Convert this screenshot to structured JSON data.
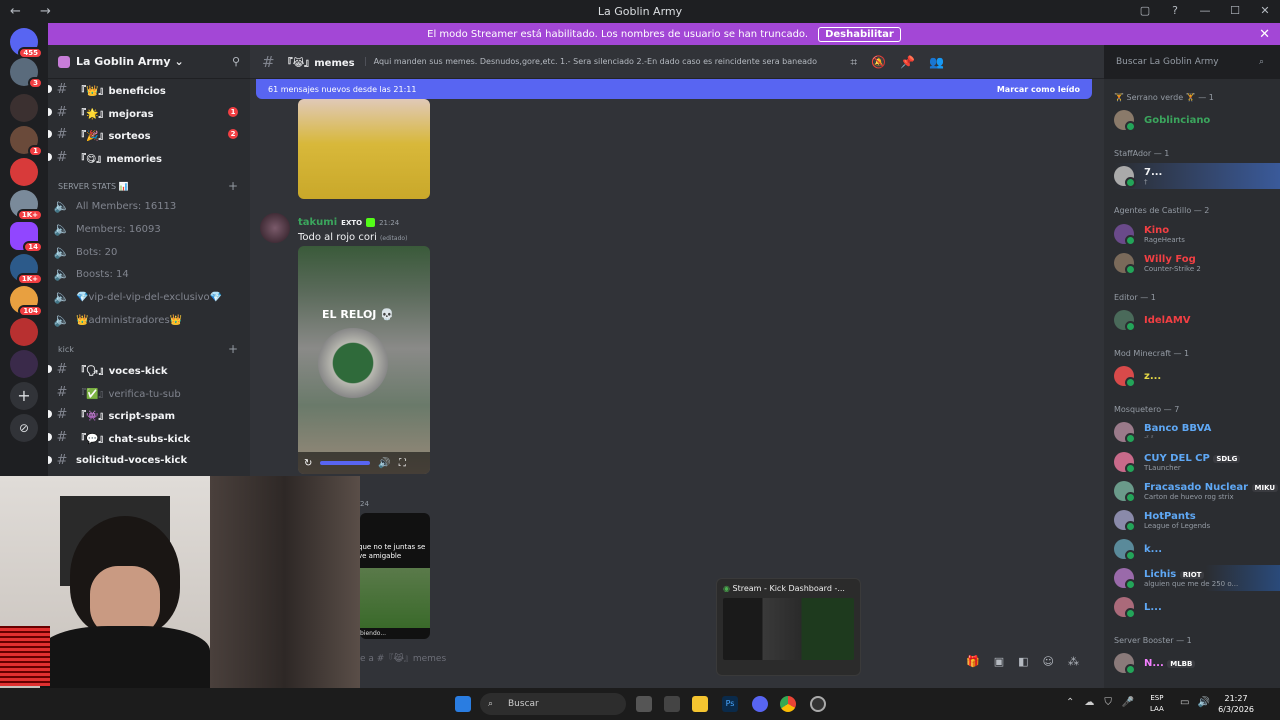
{
  "window": {
    "title": "La Goblin Army",
    "back": "←",
    "forward": "→",
    "controls": [
      "▢",
      "?",
      "—",
      "☐",
      "✕"
    ]
  },
  "banner": {
    "text": "El modo Streamer está habilitado. Los nombres de usuario se han truncado.",
    "button": "Deshabilitar",
    "close": "✕"
  },
  "servers": {
    "badges": [
      "455",
      "3",
      "1",
      "1K+",
      "14",
      "1K+",
      "104"
    ]
  },
  "guild": {
    "name": "La Goblin Army",
    "chevron": "⌄",
    "channels_top": [
      {
        "label": "『👑』beneficios",
        "unread": true
      },
      {
        "label": "『🌟』mejoras",
        "unread": true,
        "mentions": "1"
      },
      {
        "label": "『🎉』sorteos",
        "unread": true,
        "mentions": "2"
      },
      {
        "label": "『😋』memories",
        "unread": true
      }
    ],
    "category_stats": "SERVER STATS 📊",
    "stats": [
      "All Members: 16113",
      "Members: 16093",
      "Bots: 20",
      "Boosts: 14",
      "💎vip-del-vip-del-exclusivo💎",
      "👑administradores👑"
    ],
    "category_kick": "kick",
    "channels_kick": [
      {
        "label": "『🗣』voces-kick",
        "unread": true
      },
      {
        "label": "『✅』verifica-tu-sub",
        "unread": false
      },
      {
        "label": "『👾』script-spam",
        "unread": true
      },
      {
        "label": "『💬』chat-subs-kick",
        "unread": true
      },
      {
        "label": "solicitud-voces-kick",
        "unread": true
      }
    ]
  },
  "channel": {
    "name": "『😹』memes",
    "topic": "Aqui manden sus memes. Desnudos,gore,etc. 1.- Sera silenciado 2.-En dado caso es reincidente sera baneado",
    "search_placeholder": "Buscar La Goblin Army",
    "new_messages": "61 mensajes nuevos desde las 21:11",
    "mark_read": "Marcar como leído",
    "composer_placeholder": "e a #『😹』memes"
  },
  "messages": [
    {
      "author": "takumi",
      "tag": "EXTO",
      "time": "21:24",
      "text": "Todo al rojo cori",
      "edited": "(editado)",
      "overlay": "EL RELOJ 💀"
    },
    {
      "time_partial": "24",
      "overlay": "que no te juntas se ve amigable",
      "sub": "biendo..."
    }
  ],
  "members": {
    "groups": [
      {
        "label": "🏋 Serrano verde 🏋 — 1",
        "items": [
          {
            "name": "Goblinciano",
            "color": "#3ba55d",
            "activity": ""
          }
        ]
      },
      {
        "label": "StaffAdor — 1",
        "items": [
          {
            "name": "7...",
            "color": "#f2f3f5",
            "activity": "†"
          }
        ]
      },
      {
        "label": "Agentes de Castillo — 2",
        "items": [
          {
            "name": "Kino",
            "color": "#f23f43",
            "activity": "RageHearts"
          },
          {
            "name": "Willy Fog",
            "color": "#f23f43",
            "activity": "Counter-Strike 2"
          }
        ]
      },
      {
        "label": "Editor — 1",
        "items": [
          {
            "name": "IdelAMV",
            "color": "#f23f43",
            "activity": ""
          }
        ]
      },
      {
        "label": "Mod Minecraft — 1",
        "items": [
          {
            "name": "z...",
            "color": "#e5d945",
            "activity": ""
          }
        ]
      },
      {
        "label": "Mosquetero — 7",
        "items": [
          {
            "name": "Banco BBVA",
            "color": "#5fa8f5",
            "activity": "·ᶻ ᶻ"
          },
          {
            "name": "CUY DEL CP",
            "color": "#5fa8f5",
            "activity": "TLauncher",
            "tag": "SDLG"
          },
          {
            "name": "Fracasado Nuclear",
            "color": "#5fa8f5",
            "activity": "Carton de huevo rog strix",
            "tag": "MIKU"
          },
          {
            "name": "HotPants",
            "color": "#5fa8f5",
            "activity": "League of Legends"
          },
          {
            "name": "k...",
            "color": "#5fa8f5",
            "activity": ""
          },
          {
            "name": "Lichis",
            "color": "#5fa8f5",
            "activity": "alguien que me de 250 o...",
            "tag": "RIOT"
          },
          {
            "name": "L...",
            "color": "#5fa8f5",
            "activity": ""
          }
        ]
      },
      {
        "label": "Server Booster — 1",
        "items": [
          {
            "name": "N...",
            "color": "#f47fff",
            "activity": "",
            "tag": "MLBB"
          }
        ]
      }
    ]
  },
  "preview": {
    "title": "Stream - Kick Dashboard -..."
  },
  "taskbar": {
    "search": "Buscar",
    "lang1": "ESP",
    "lang2": "LAA",
    "time": "21:27",
    "date": "6/3/2026"
  }
}
